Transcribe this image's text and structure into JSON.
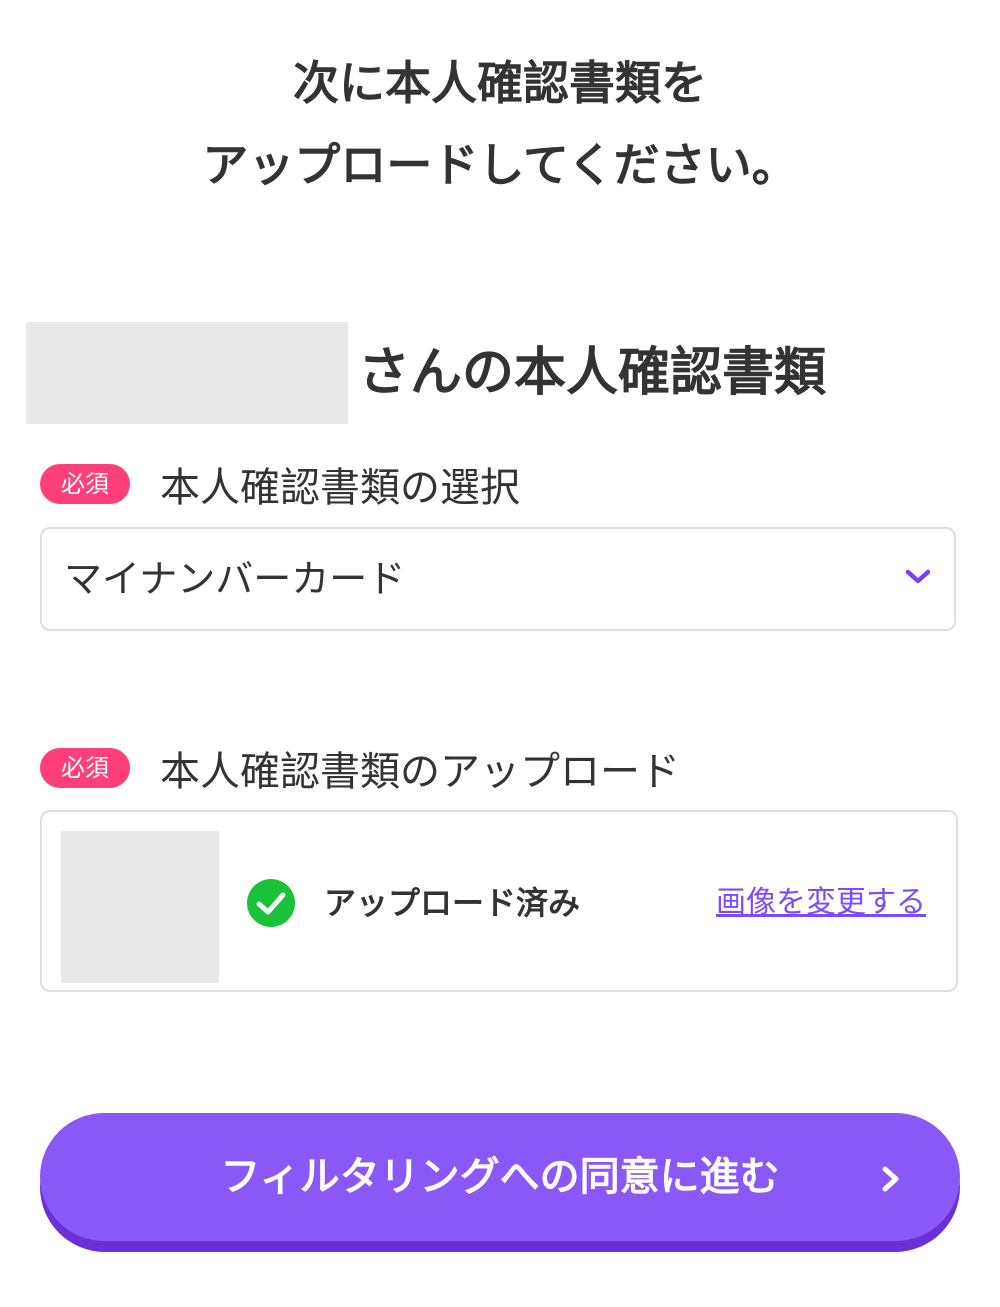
{
  "heading": {
    "line1": "次に本人確認書類を",
    "line2": "アップロードしてください。"
  },
  "owner": {
    "title_suffix": "さんの本人確認書類"
  },
  "document_select": {
    "required_badge": "必須",
    "label": "本人確認書類の選択",
    "selected_value": "マイナンバーカード",
    "dropdown_icon": "chevron-down-icon"
  },
  "document_upload": {
    "required_badge": "必須",
    "label": "本人確認書類のアップロード",
    "status_icon": "check-circle-icon",
    "status": "アップロード済み",
    "change_link": "画像を変更する"
  },
  "cta": {
    "label": "フィルタリングへの同意に進む",
    "icon": "chevron-right-icon"
  },
  "colors": {
    "accent": "#8a58f7",
    "accent_shadow": "#6a2fd6",
    "required_badge": "#ff3f7a",
    "success": "#18c33a",
    "link": "#7b4bff",
    "text": "#333333",
    "border": "#dedede",
    "placeholder": "#e9e9e9"
  }
}
